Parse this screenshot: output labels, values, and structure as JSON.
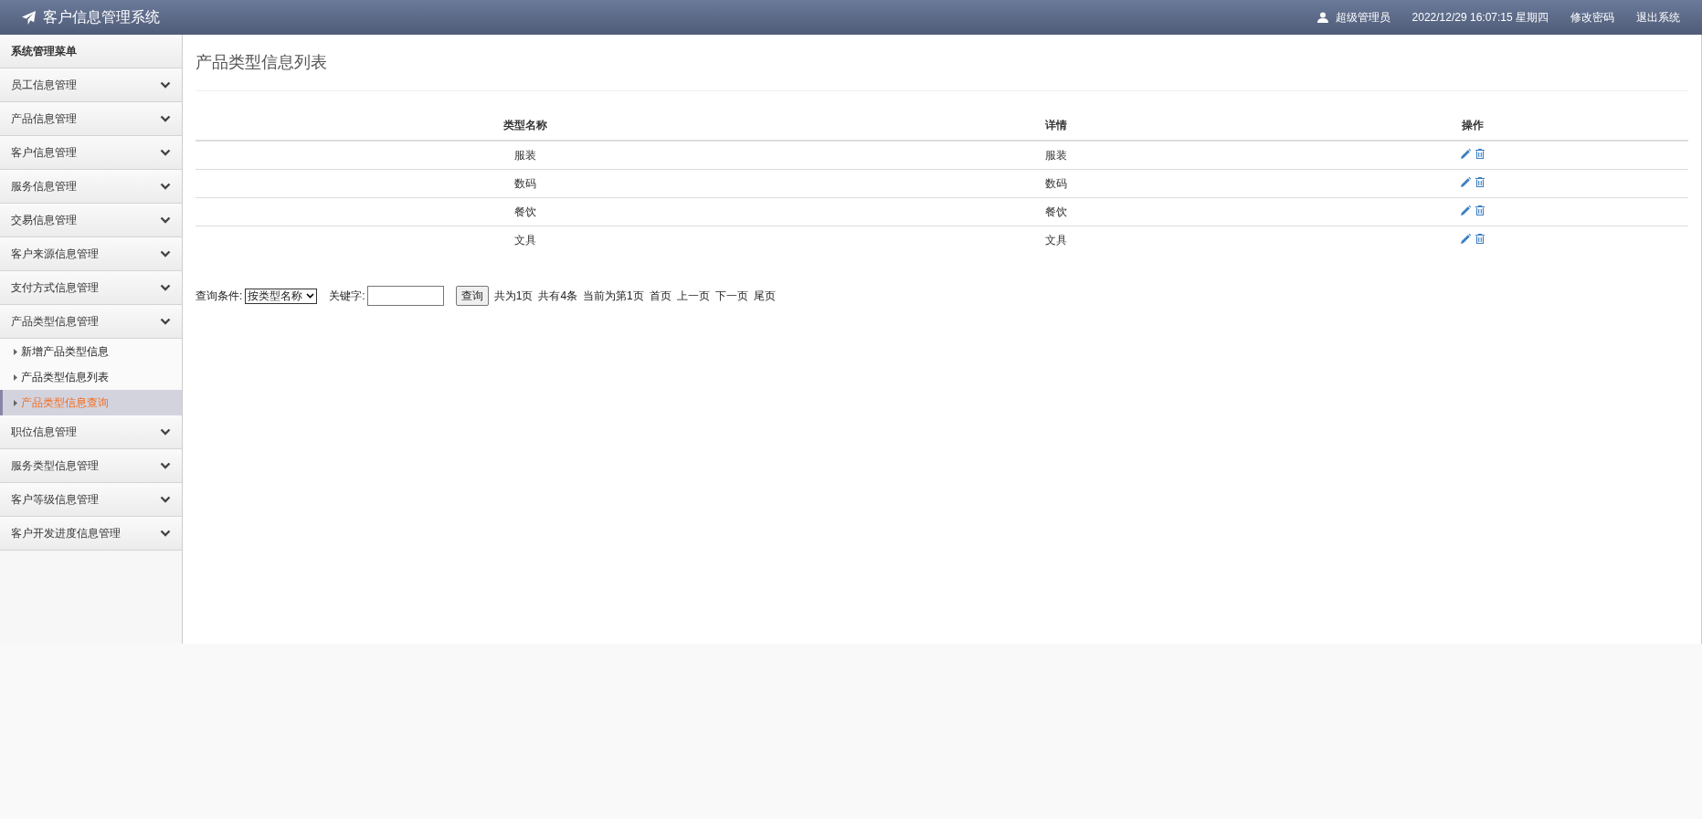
{
  "header": {
    "title": "客户信息管理系统",
    "user": "超级管理员",
    "datetime": "2022/12/29 16:07:15 星期四",
    "links": [
      "修改密码",
      "退出系统"
    ]
  },
  "sidebar": {
    "title": "系统管理菜单",
    "groups": [
      {
        "label": "员工信息管理"
      },
      {
        "label": "产品信息管理"
      },
      {
        "label": "客户信息管理"
      },
      {
        "label": "服务信息管理"
      },
      {
        "label": "交易信息管理"
      },
      {
        "label": "客户来源信息管理"
      },
      {
        "label": "支付方式信息管理"
      },
      {
        "label": "产品类型信息管理",
        "children": [
          {
            "label": "新增产品类型信息",
            "selected": false
          },
          {
            "label": "产品类型信息列表",
            "selected": false
          },
          {
            "label": "产品类型信息查询",
            "selected": true
          }
        ]
      },
      {
        "label": "职位信息管理"
      },
      {
        "label": "服务类型信息管理"
      },
      {
        "label": "客户等级信息管理"
      },
      {
        "label": "客户开发进度信息管理"
      }
    ]
  },
  "page_title": "产品类型信息列表",
  "table": {
    "columns": [
      "类型名称",
      "详情",
      "操作"
    ],
    "rows": [
      [
        "服装",
        "服装"
      ],
      [
        "数码",
        "数码"
      ],
      [
        "餐饮",
        "餐饮"
      ],
      [
        "文具",
        "文具"
      ]
    ]
  },
  "search": {
    "condition_label": "查询条件:",
    "condition_value": "按类型名称",
    "keyword_label": "关键字:",
    "button": "查询"
  },
  "pagination": [
    "共为1页",
    "共有4条",
    "当前为第1页",
    "首页",
    "上一页",
    "下一页",
    "尾页"
  ]
}
